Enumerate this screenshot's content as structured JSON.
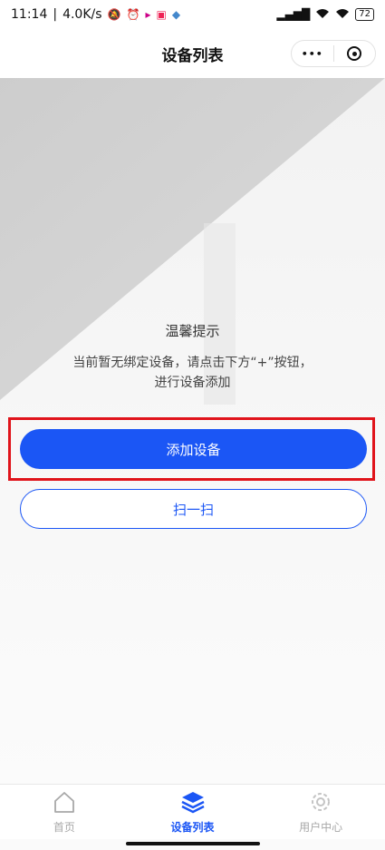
{
  "status_bar": {
    "time": "11:14",
    "speed": "4.0K/s",
    "battery": "72"
  },
  "nav": {
    "title": "设备列表",
    "more_glyph": "•••"
  },
  "notice": {
    "title": "温馨提示",
    "line1": "当前暂无绑定设备，请点击下方“+”按钮，",
    "line2": "进行设备添加"
  },
  "buttons": {
    "add_device": "添加设备",
    "scan": "扫一扫"
  },
  "tabs": [
    {
      "label": "首页",
      "icon": "home-icon"
    },
    {
      "label": "设备列表",
      "icon": "layers-icon"
    },
    {
      "label": "用户中心",
      "icon": "gear-icon"
    }
  ],
  "colors": {
    "accent": "#1b56f5",
    "highlight": "#e0141b",
    "inactive": "#a8a8a8"
  }
}
